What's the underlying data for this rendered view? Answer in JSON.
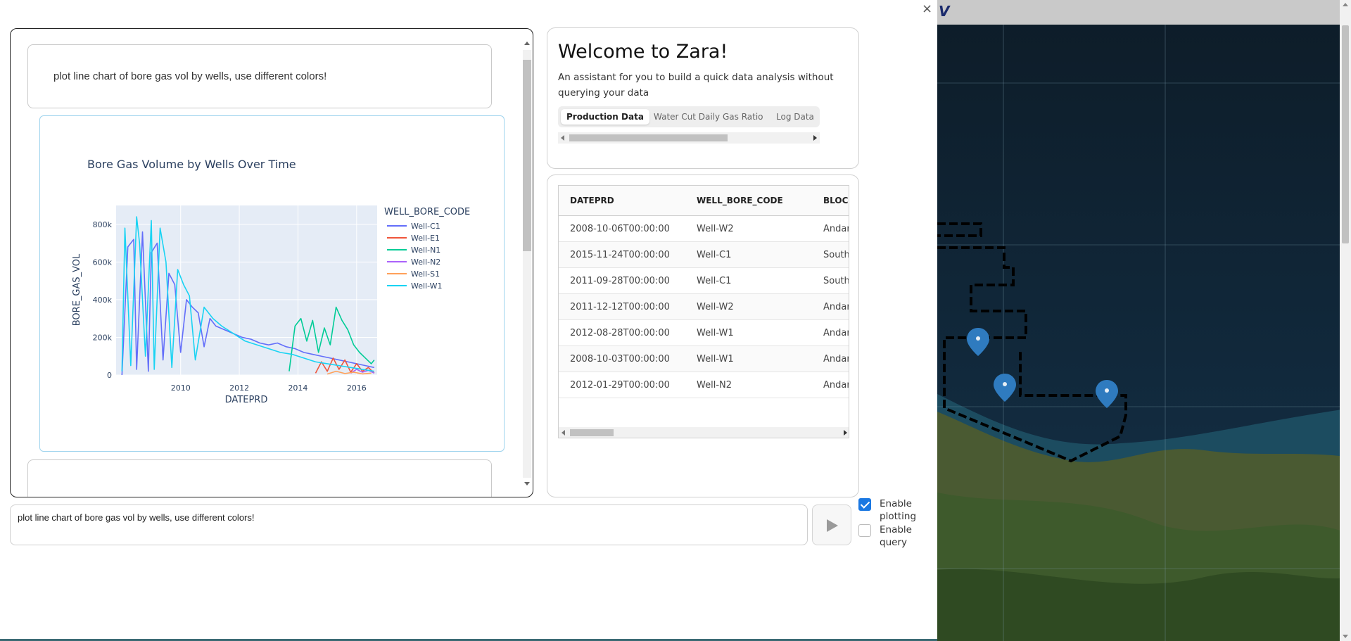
{
  "app": {
    "close_label": "×",
    "map_logo": "V"
  },
  "chat": {
    "user_message": "plot line chart of bore gas vol by wells, use different colors!"
  },
  "chart_data": {
    "type": "line",
    "title": "Bore Gas Volume by Wells Over Time",
    "xlabel": "DATEPRD",
    "ylabel": "BORE_GAS_VOL",
    "legend_title": "WELL_BORE_CODE",
    "legend_position": "right",
    "xlim": [
      2007.8,
      2016.7
    ],
    "ylim": [
      0,
      900000
    ],
    "x_ticks": [
      2010,
      2012,
      2014,
      2016
    ],
    "y_ticks": [
      0,
      200000,
      400000,
      600000,
      800000
    ],
    "y_tick_labels": [
      "0",
      "200k",
      "400k",
      "600k",
      "800k"
    ],
    "plot_bg": "#e5ecf6",
    "series": [
      {
        "name": "Well-C1",
        "color": "#636efa",
        "x": [
          2008.0,
          2008.2,
          2008.4,
          2008.5,
          2008.7,
          2008.9,
          2009.0,
          2009.2,
          2009.4,
          2009.6,
          2009.8,
          2010.0,
          2010.2,
          2010.4,
          2010.6,
          2010.8,
          2011.0,
          2011.2,
          2011.5,
          2011.8,
          2012.1,
          2012.4,
          2012.7,
          2013.0,
          2013.3,
          2013.6,
          2013.9,
          2014.2,
          2014.5,
          2014.8,
          2015.1,
          2015.4,
          2015.7,
          2016.0,
          2016.3,
          2016.6
        ],
        "y": [
          0,
          680000,
          720000,
          30000,
          760000,
          20000,
          650000,
          700000,
          80000,
          540000,
          480000,
          120000,
          400000,
          360000,
          330000,
          150000,
          300000,
          260000,
          240000,
          220000,
          200000,
          190000,
          170000,
          160000,
          170000,
          150000,
          140000,
          120000,
          110000,
          100000,
          90000,
          80000,
          70000,
          60000,
          50000,
          40000
        ]
      },
      {
        "name": "Well-E1",
        "color": "#ef553b",
        "x": [
          2014.6,
          2014.8,
          2015.0,
          2015.2,
          2015.4,
          2015.6,
          2015.8,
          2016.0,
          2016.2,
          2016.4,
          2016.6
        ],
        "y": [
          10000,
          70000,
          20000,
          90000,
          30000,
          80000,
          15000,
          60000,
          20000,
          40000,
          10000
        ]
      },
      {
        "name": "Well-N1",
        "color": "#00cc96",
        "x": [
          2013.7,
          2013.9,
          2014.1,
          2014.3,
          2014.5,
          2014.7,
          2014.9,
          2015.1,
          2015.3,
          2015.5,
          2015.7,
          2015.9,
          2016.1,
          2016.3,
          2016.5,
          2016.6
        ],
        "y": [
          20000,
          260000,
          300000,
          180000,
          290000,
          120000,
          250000,
          160000,
          360000,
          290000,
          240000,
          160000,
          120000,
          90000,
          60000,
          80000
        ]
      },
      {
        "name": "Well-N2",
        "color": "#ab63fa",
        "x": [
          2015.8,
          2016.0,
          2016.2,
          2016.4,
          2016.6
        ],
        "y": [
          10000,
          30000,
          15000,
          25000,
          10000
        ]
      },
      {
        "name": "Well-S1",
        "color": "#ffa15a",
        "x": [
          2015.0,
          2015.3,
          2015.6,
          2015.9,
          2016.2,
          2016.5
        ],
        "y": [
          5000,
          20000,
          8000,
          15000,
          6000,
          10000
        ]
      },
      {
        "name": "Well-W1",
        "color": "#19d3f3",
        "x": [
          2008.0,
          2008.1,
          2008.3,
          2008.5,
          2008.6,
          2008.8,
          2009.0,
          2009.1,
          2009.3,
          2009.5,
          2009.7,
          2009.9,
          2010.1,
          2010.3,
          2010.5,
          2010.8,
          2011.1,
          2011.4,
          2011.8,
          2012.2,
          2012.6,
          2013.0,
          2013.4,
          2013.8,
          2014.2,
          2014.6,
          2015.0,
          2015.4,
          2015.8,
          2016.2,
          2016.6
        ],
        "y": [
          20000,
          780000,
          50000,
          840000,
          700000,
          100000,
          820000,
          30000,
          780000,
          600000,
          40000,
          560000,
          480000,
          420000,
          80000,
          360000,
          300000,
          260000,
          220000,
          180000,
          160000,
          140000,
          120000,
          110000,
          90000,
          70000,
          60000,
          50000,
          40000,
          30000,
          20000
        ]
      }
    ]
  },
  "info": {
    "title": "Welcome to Zara!",
    "description": "An assistant for you to build a quick data analysis without querying your data",
    "tabs": [
      "Production Data",
      "Water Cut Daily Gas Ratio",
      "Log Data"
    ]
  },
  "table": {
    "columns": [
      "DATEPRD",
      "WELL_BORE_CODE",
      "BLOC"
    ],
    "rows": [
      [
        "2008-10-06T00:00:00",
        "Well-W2",
        "Andar"
      ],
      [
        "2015-11-24T00:00:00",
        "Well-C1",
        "South"
      ],
      [
        "2011-09-28T00:00:00",
        "Well-C1",
        "South"
      ],
      [
        "2011-12-12T00:00:00",
        "Well-W2",
        "Andar"
      ],
      [
        "2012-08-28T00:00:00",
        "Well-W1",
        "Andar"
      ],
      [
        "2008-10-03T00:00:00",
        "Well-W1",
        "Andar"
      ],
      [
        "2012-01-29T00:00:00",
        "Well-N2",
        "Andar"
      ]
    ]
  },
  "input": {
    "value": "plot line chart of bore gas vol by wells, use different colors!"
  },
  "options": {
    "plotting_label": "Enable plotting",
    "plotting_checked": true,
    "query_label": "Enable query",
    "query_checked": false
  }
}
